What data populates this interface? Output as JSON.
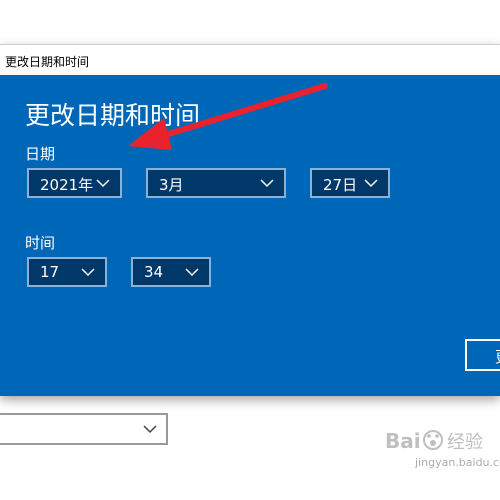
{
  "window": {
    "titlebar_text": "更改日期和时间"
  },
  "dialog": {
    "heading": "更改日期和时间",
    "date_label": "日期",
    "time_label": "时间",
    "year_value": "2021年",
    "month_value": "3月",
    "day_value": "27日",
    "hour_value": "17",
    "minute_value": "34",
    "update_button_label": "更"
  },
  "background": {
    "dropdown_value": ""
  },
  "watermark": {
    "text": "Baidu 经验",
    "subtext": "jingyan.baidu.com"
  },
  "colors": {
    "dialog_bg": "#0067b8",
    "dropdown_bg": "#00386a",
    "dropdown_border": "#8ab2d8",
    "annotation_arrow": "#e8232d"
  },
  "icons": {
    "dropdown_chevron": "chevron-down-icon",
    "annotation": "red-arrow-annotation"
  }
}
